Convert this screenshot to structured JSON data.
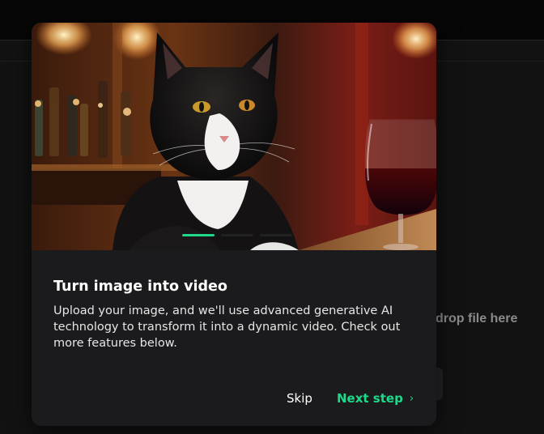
{
  "background": {
    "drop_text": "drop file here"
  },
  "onboarding": {
    "hero_image": "cat-with-wine-glass",
    "progress": {
      "total_steps": 3,
      "current_step": 1
    },
    "title": "Turn image into video",
    "description": "Upload your image, and we'll use advanced generative AI technology to transform it into a dynamic video. Check out more features below.",
    "skip_label": "Skip",
    "next_label": "Next step",
    "next_icon": "›"
  },
  "colors": {
    "accent": "#1ed98a",
    "modal_bg": "#1b1b1d",
    "page_bg": "#121212"
  }
}
